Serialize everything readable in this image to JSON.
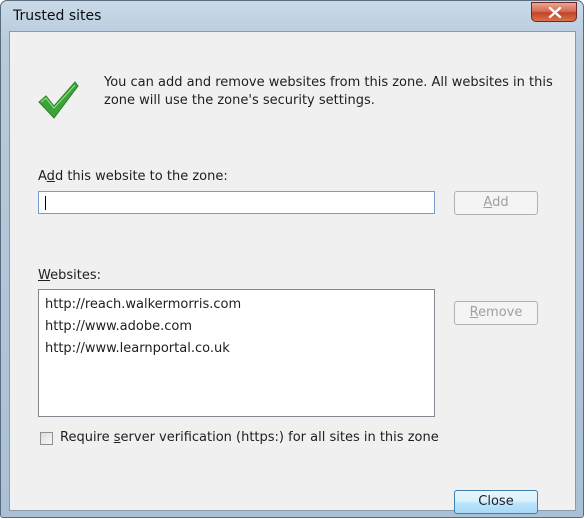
{
  "window": {
    "title": "Trusted sites"
  },
  "icons": {
    "check": "checkmark-icon",
    "close": "close-icon"
  },
  "colors": {
    "check": "#3aa43a",
    "close_button": "#c3432a"
  },
  "description": "You can add and remove websites from this zone. All websites in this zone will use the zone's security settings.",
  "add": {
    "label_pre": "A",
    "label_key": "d",
    "label_post": "d this website to the zone:",
    "input_value": "",
    "button_key": "A",
    "button_post": "dd",
    "button_enabled": false
  },
  "websites": {
    "label_key": "W",
    "label_post": "ebsites:",
    "items": [
      "http://reach.walkermorris.com",
      "http://www.adobe.com",
      "http://www.learnportal.co.uk"
    ],
    "remove_key": "R",
    "remove_post": "emove",
    "remove_enabled": false
  },
  "require": {
    "pre": "Require ",
    "key": "s",
    "post": "erver verification (https:) for all sites in this zone",
    "checked": false
  },
  "close_label": "Close"
}
